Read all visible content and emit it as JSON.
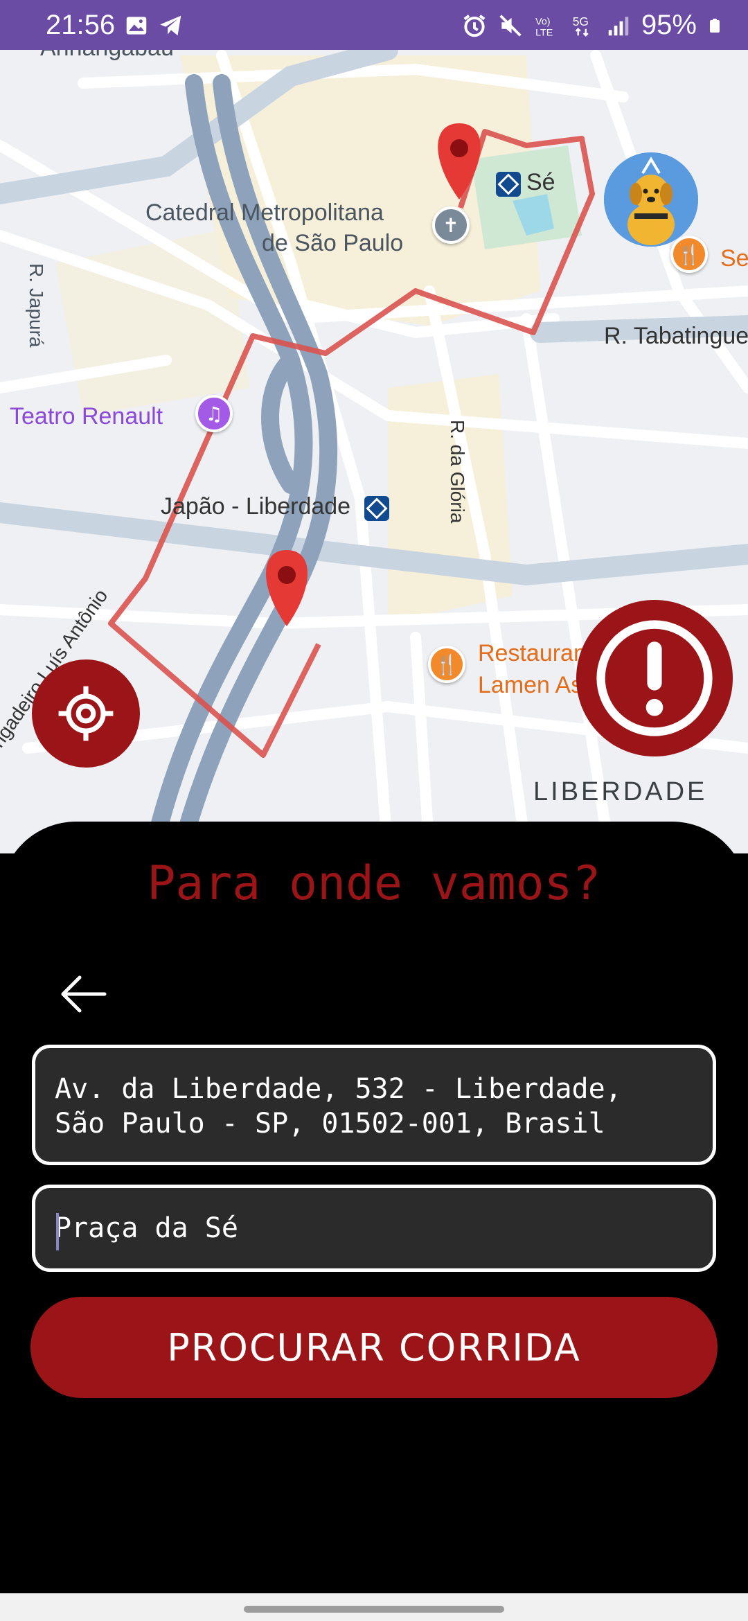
{
  "status_bar": {
    "time": "21:56",
    "battery": "95%",
    "network": "5G",
    "icons": [
      "image-icon",
      "telegram-icon",
      "alarm-icon",
      "mute-icon",
      "volte-icon",
      "5g-icon",
      "signal-icon",
      "battery-icon"
    ]
  },
  "map": {
    "labels": {
      "top_partial": "Anhangabaú",
      "se_station": "Sé",
      "catedral_line1": "Catedral Metropolitana",
      "catedral_line2": "de São Paulo",
      "r_japura": "R. Japurá",
      "r_tabatinga": "R. Tabatinguera",
      "teatro": "Teatro Renault",
      "japao_station": "Japão - Liberdade",
      "r_gloria": "R. da Glória",
      "restaurant_line1": "Restaurante",
      "restaurant_line2": "Lamen Aska",
      "restaurant_right": "Se",
      "brigadeiro": "Brigadeiro Luís Antônio",
      "district": "LIBERDADE"
    },
    "route_color": "#d9534f",
    "pin_color": "#e53935"
  },
  "sheet": {
    "title": "Para onde vamos?",
    "origin_line1": "Av. da Liberdade, 532 - Liberdade,",
    "origin_line2": "São Paulo - SP, 01502-001, Brasil",
    "destination": "Praça da Sé",
    "search_button": "PROCURAR CORRIDA"
  },
  "colors": {
    "accent": "#9b1518",
    "status_bar": "#6a4ca5",
    "sheet_bg": "#000000",
    "field_bg": "#2b2b2b"
  }
}
